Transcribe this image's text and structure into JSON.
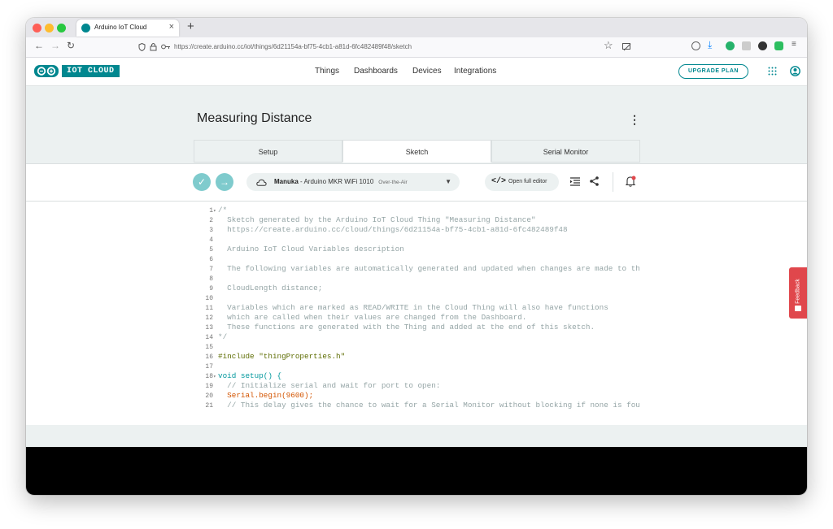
{
  "browser": {
    "tab_title": "Arduino IoT Cloud",
    "tab_close": "×",
    "new_tab": "+",
    "url": "https://create.arduino.cc/iot/things/6d21154a-bf75-4cb1-a81d-6fc482489f48/sketch",
    "back": "←",
    "forward": "→",
    "reload": "↻",
    "star": "☆"
  },
  "header": {
    "logo_text": "IOT CLOUD",
    "nav": [
      "Things",
      "Dashboards",
      "Devices",
      "Integrations"
    ],
    "upgrade": "UPGRADE PLAN"
  },
  "page": {
    "title": "Measuring Distance",
    "more": "⋮",
    "tabs": [
      "Setup",
      "Sketch",
      "Serial Monitor"
    ],
    "active_tab": "Sketch"
  },
  "toolbar": {
    "verify": "✓",
    "upload": "→",
    "device_name": "Manuka",
    "device_board": " - Arduino MKR WiFi 1010",
    "device_mode": "Over-the-Air",
    "dropdown": "▼",
    "open_editor_icon": "</>",
    "open_editor": "Open full editor",
    "indent_icon": "☰",
    "share_icon": "⋖",
    "bell_icon": "♫"
  },
  "code_lines": [
    {
      "n": "1",
      "fold": "▾",
      "t": "/*",
      "k": "cm"
    },
    {
      "n": "2",
      "fold": "",
      "t": "  Sketch generated by the Arduino IoT Cloud Thing \"Measuring Distance\"",
      "k": "cm"
    },
    {
      "n": "3",
      "fold": "",
      "t": "  https://create.arduino.cc/cloud/things/6d21154a-bf75-4cb1-a81d-6fc482489f48",
      "k": "cm"
    },
    {
      "n": "4",
      "fold": "",
      "t": "",
      "k": "cm"
    },
    {
      "n": "5",
      "fold": "",
      "t": "  Arduino IoT Cloud Variables description",
      "k": "cm"
    },
    {
      "n": "6",
      "fold": "",
      "t": "",
      "k": "cm"
    },
    {
      "n": "7",
      "fold": "",
      "t": "  The following variables are automatically generated and updated when changes are made to the",
      "k": "cm"
    },
    {
      "n": "8",
      "fold": "",
      "t": "",
      "k": "cm"
    },
    {
      "n": "9",
      "fold": "",
      "t": "  CloudLength distance;",
      "k": "cm"
    },
    {
      "n": "10",
      "fold": "",
      "t": "",
      "k": "cm"
    },
    {
      "n": "11",
      "fold": "",
      "t": "  Variables which are marked as READ/WRITE in the Cloud Thing will also have functions",
      "k": "cm"
    },
    {
      "n": "12",
      "fold": "",
      "t": "  which are called when their values are changed from the Dashboard.",
      "k": "cm"
    },
    {
      "n": "13",
      "fold": "",
      "t": "  These functions are generated with the Thing and added at the end of this sketch.",
      "k": "cm"
    },
    {
      "n": "14",
      "fold": "",
      "t": "*/",
      "k": "cm"
    },
    {
      "n": "15",
      "fold": "",
      "t": "",
      "k": "cm"
    },
    {
      "n": "16",
      "fold": "",
      "t": "#include \"thingProperties.h\"",
      "k": "plain"
    },
    {
      "n": "17",
      "fold": "",
      "t": "",
      "k": "cm"
    },
    {
      "n": "18",
      "fold": "▾",
      "t": "void setup() {",
      "k": "plain"
    },
    {
      "n": "19",
      "fold": "",
      "t": "  // Initialize serial and wait for port to open:",
      "k": "cm"
    },
    {
      "n": "20",
      "fold": "",
      "t": "  Serial.begin(9600);",
      "k": "plain"
    },
    {
      "n": "21",
      "fold": "",
      "t": "  // This delay gives the chance to wait for a Serial Monitor without blocking if none is found",
      "k": "cm"
    }
  ],
  "feedback": "Feedback",
  "colors": {
    "teal": "#00878f",
    "feedback": "#e0474c",
    "page_bg": "#ecf1f1"
  }
}
